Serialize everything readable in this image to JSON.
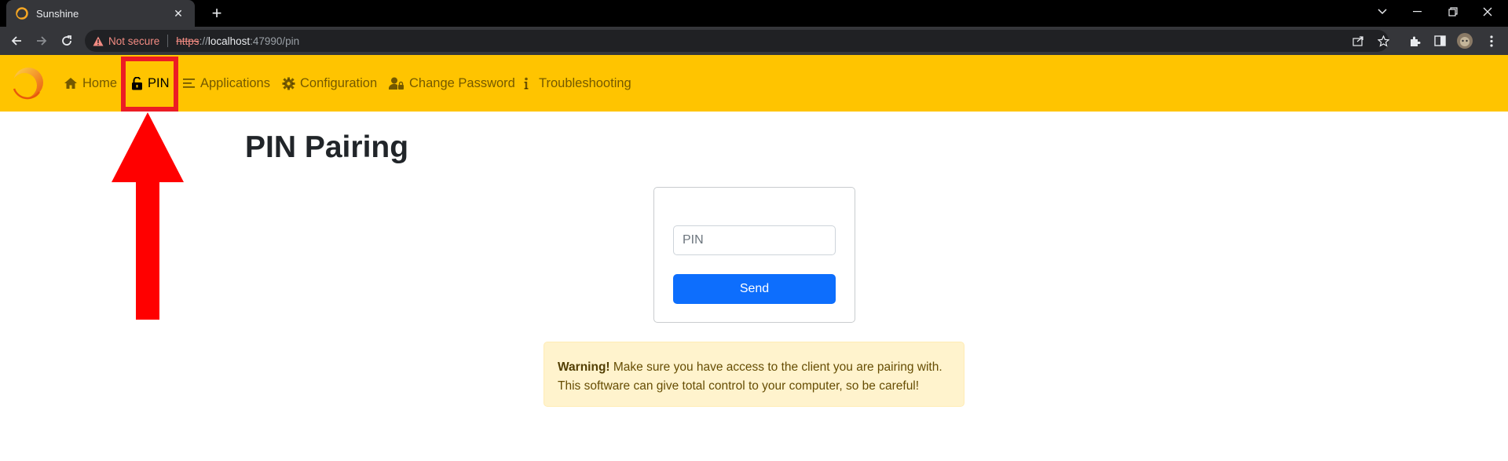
{
  "browser": {
    "tab_title": "Sunshine",
    "tab_close": "✕",
    "new_tab": "+",
    "security_label": "Not secure",
    "url_scheme": "https",
    "url_separator": "://",
    "url_host": "localhost",
    "url_rest": ":47990/pin"
  },
  "nav": {
    "items": [
      {
        "label": "Home",
        "icon": "home-icon"
      },
      {
        "label": "PIN",
        "icon": "unlock-icon",
        "active": true
      },
      {
        "label": "Applications",
        "icon": "list-icon"
      },
      {
        "label": "Configuration",
        "icon": "gear-icon"
      },
      {
        "label": "Change Password",
        "icon": "user-lock-icon"
      },
      {
        "label": "Troubleshooting",
        "icon": "info-icon"
      }
    ],
    "background": "#ffc400"
  },
  "main": {
    "title": "PIN Pairing",
    "pin_placeholder": "PIN",
    "send_label": "Send",
    "warning_bold": "Warning!",
    "warning_line1": " Make sure you have access to the client you are pairing with.",
    "warning_line2": "This software can give total control to your computer, so be careful!"
  },
  "annotation": {
    "color": "#ec1c24"
  }
}
